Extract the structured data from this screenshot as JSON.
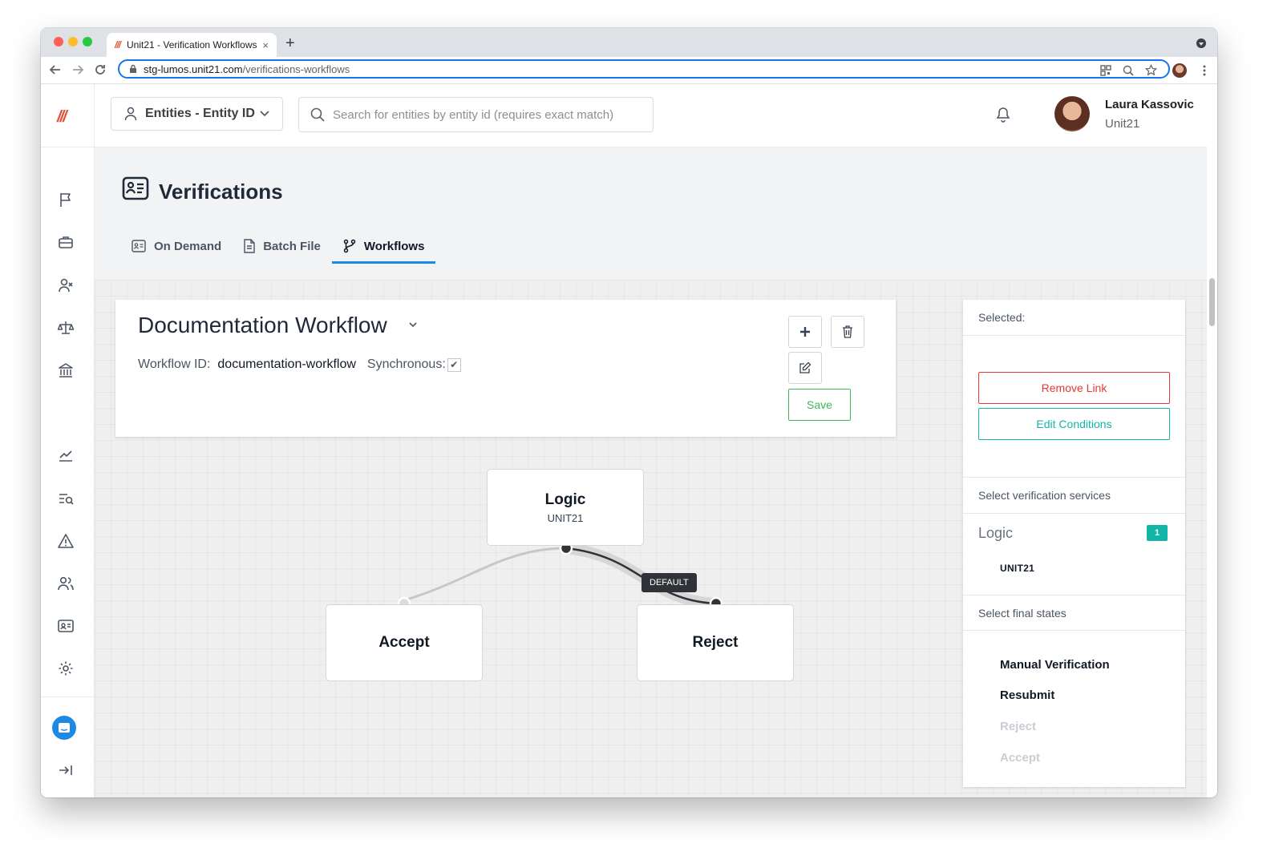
{
  "browser": {
    "tab_title": "Unit21 - Verification Workflows",
    "tab_favicon": "///",
    "tab_close": "×",
    "new_tab": "+",
    "url_host": "stg-lumos.unit21.com",
    "url_path": "/verifications-workflows"
  },
  "colors": {
    "brand": "#e0533a",
    "accent": "#1e88e5",
    "save_green": "#3cba54",
    "remove_red": "#e53935",
    "teal": "#13b5a7"
  },
  "header": {
    "entity_select": "Entities - Entity ID",
    "search_placeholder": "Search for entities by entity id (requires exact match)",
    "user_name": "Laura Kassovic",
    "user_org": "Unit21"
  },
  "sidebar": {
    "logo": "///",
    "icons": [
      "flag-icon",
      "briefcase-icon",
      "user-x-icon",
      "scale-icon",
      "bank-icon",
      "chart-icon",
      "search-list-icon",
      "alert-icon",
      "users-icon",
      "id-card-icon",
      "gear-icon",
      "chat-icon",
      "collapse-icon"
    ]
  },
  "page": {
    "title": "Verifications",
    "tabs": [
      {
        "label": "On Demand",
        "icon": "id-card-icon"
      },
      {
        "label": "Batch File",
        "icon": "file-icon"
      },
      {
        "label": "Workflows",
        "icon": "branch-icon"
      }
    ],
    "active_tab": "Workflows"
  },
  "workflow": {
    "name": "Documentation Workflow",
    "id_label": "Workflow ID:",
    "id_value": "documentation-workflow",
    "sync_label": "Synchronous:",
    "synchronous": true,
    "save_label": "Save"
  },
  "graph": {
    "nodes": [
      {
        "title": "Logic",
        "subtitle": "UNIT21"
      },
      {
        "title": "Accept",
        "subtitle": ""
      },
      {
        "title": "Reject",
        "subtitle": ""
      }
    ],
    "edge_label": "DEFAULT"
  },
  "side_panel": {
    "selected_label": "Selected:",
    "remove_link": "Remove Link",
    "edit_conditions": "Edit Conditions",
    "select_services_label": "Select verification services",
    "service_group": "Logic",
    "service_count": "1",
    "service_item": "UNIT21",
    "select_final_states_label": "Select final states",
    "final_states": [
      {
        "label": "Manual Verification",
        "enabled": true
      },
      {
        "label": "Resubmit",
        "enabled": true
      },
      {
        "label": "Reject",
        "enabled": false
      },
      {
        "label": "Accept",
        "enabled": false
      }
    ]
  }
}
